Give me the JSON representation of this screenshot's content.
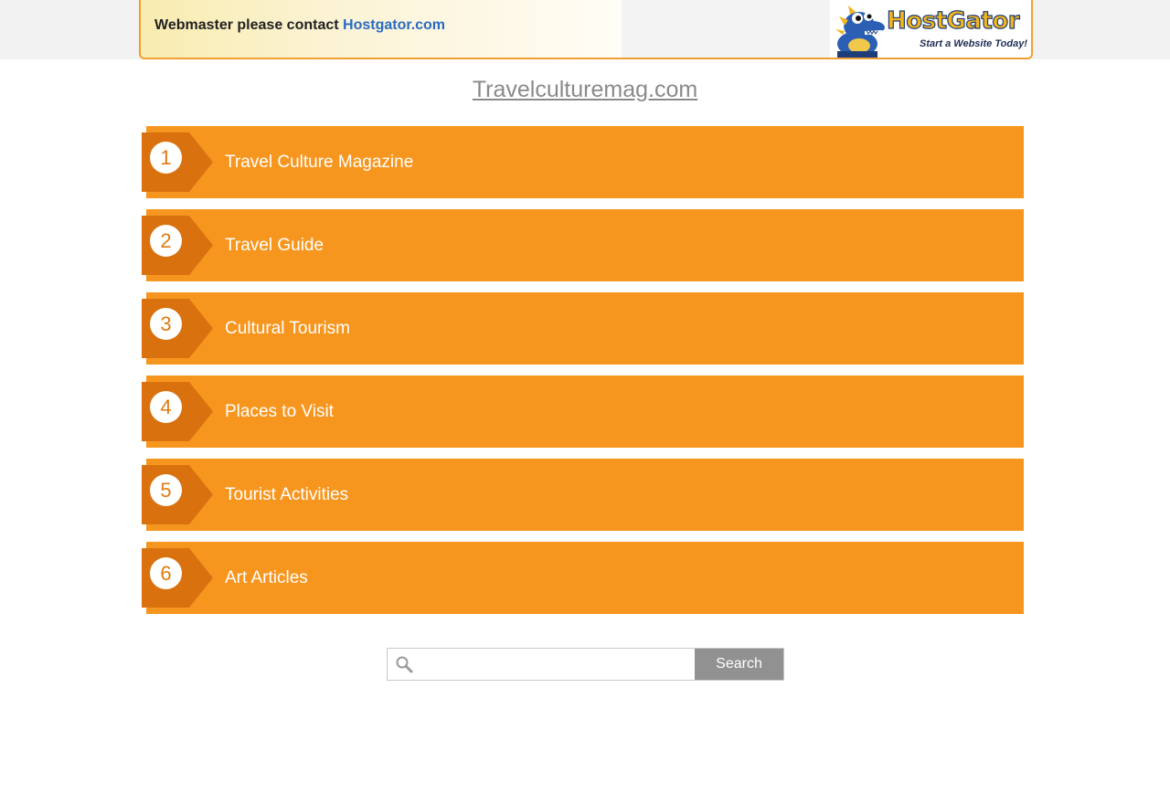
{
  "banner": {
    "message": "Webmaster please contact ",
    "link_text": "Hostgator.com",
    "logo_title": "HostGator",
    "logo_tagline": "Start a Website Today!",
    "mascot_icon": "gator-mascot-icon"
  },
  "domain": {
    "title": "Travelculturemag.com"
  },
  "links": [
    {
      "number": "1",
      "label": "Travel Culture Magazine"
    },
    {
      "number": "2",
      "label": "Travel Guide"
    },
    {
      "number": "3",
      "label": "Cultural Tourism"
    },
    {
      "number": "4",
      "label": "Places to Visit"
    },
    {
      "number": "5",
      "label": "Tourist Activities"
    },
    {
      "number": "6",
      "label": "Art Articles"
    }
  ],
  "search": {
    "placeholder": "",
    "value": "",
    "button_label": "Search",
    "icon": "search-icon"
  },
  "colors": {
    "accent_orange": "#f7961e",
    "tab_orange": "#d9720e",
    "link_blue": "#2a6bc2",
    "button_gray": "#919191"
  }
}
